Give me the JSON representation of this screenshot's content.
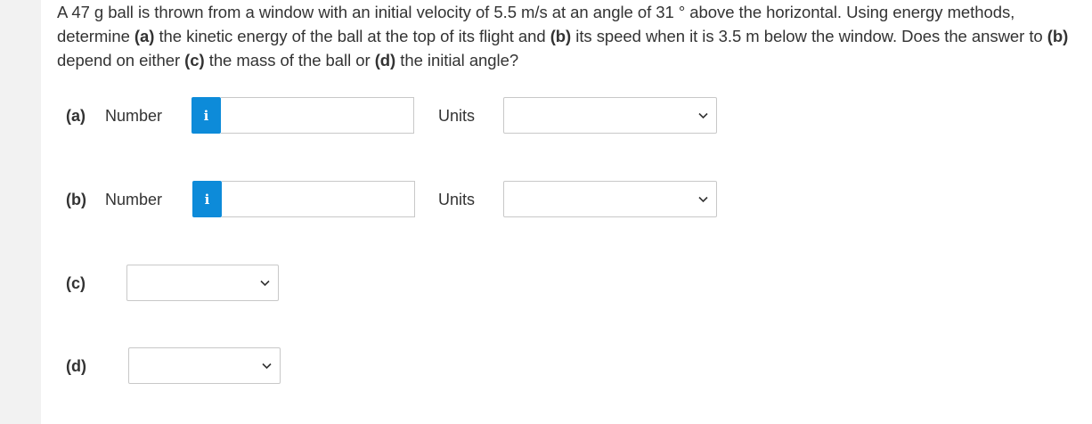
{
  "question": {
    "t1": "A 47 g ball is thrown from a window with an initial velocity of 5.5 m/s at an angle of 31 ° above the horizontal. Using energy methods, determine ",
    "a_marker": "(a)",
    "t2": " the kinetic energy of the ball at the top of its flight and ",
    "b_marker": "(b)",
    "t3": " its speed when it is 3.5 m below the window. Does the answer to ",
    "b_marker_2": "(b)",
    "t4": " depend on either ",
    "c_marker": "(c)",
    "t5": " the mass of the ball or ",
    "d_marker": "(d)",
    "t6": " the initial angle?"
  },
  "parts": {
    "a": {
      "label": "(a)",
      "number_label": "Number",
      "info_icon": "i",
      "value": "",
      "units_label": "Units",
      "units_selected": ""
    },
    "b": {
      "label": "(b)",
      "number_label": "Number",
      "info_icon": "i",
      "value": "",
      "units_label": "Units",
      "units_selected": ""
    },
    "c": {
      "label": "(c)",
      "selected": ""
    },
    "d": {
      "label": "(d)",
      "selected": ""
    }
  },
  "colors": {
    "info_button": "#0d8bd9",
    "text": "#333333",
    "border": "#c8c8c8",
    "gutter": "#f2f2f2"
  },
  "icons": {
    "info": "info-icon",
    "dropdown": "chevron-down-icon"
  }
}
